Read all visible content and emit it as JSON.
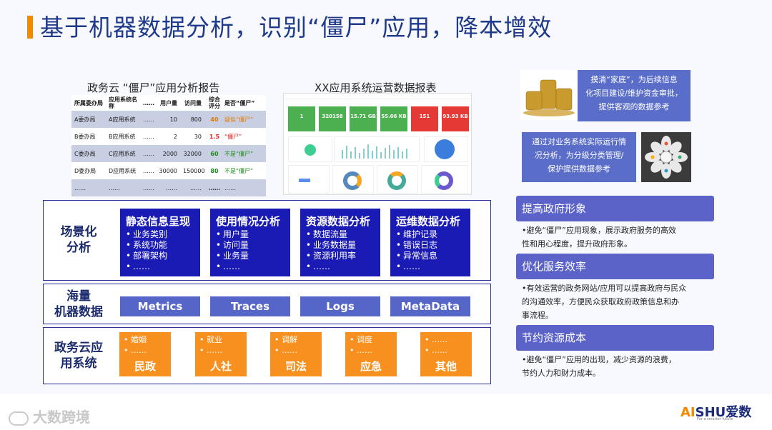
{
  "title": "基于机器数据分析，识别“僵尸”应用，降本增效",
  "report": {
    "heading": "政务云 “僵尸”应用分析报告",
    "columns": [
      "所属委办局",
      "应用系统名称",
      "……",
      "用户量",
      "访问量",
      "综合评分",
      "是否“僵尸”"
    ],
    "rows": [
      [
        "A委办局",
        "A应用系统",
        "……",
        "10",
        "800",
        "40",
        "疑似“僵尸”"
      ],
      [
        "B委办局",
        "B应用系统",
        "……",
        "2",
        "30",
        "1.5",
        "“僵尸”"
      ],
      [
        "C委办局",
        "C应用系统",
        "……",
        "2000",
        "32000",
        "60",
        "不是“僵尸”"
      ],
      [
        "D委办局",
        "D应用系统",
        "……",
        "30000",
        "150000",
        "80",
        "不是“僵尸”"
      ],
      [
        "……",
        "……",
        "……",
        "……",
        "……",
        "……",
        "……"
      ]
    ],
    "score_colors": [
      "#e07a00",
      "#e02020",
      "#1a8a1a",
      "#1a8a1a",
      "#333"
    ],
    "status_colors": [
      "#e07a00",
      "#e02020",
      "#1a8a1a",
      "#1a8a1a",
      "#333"
    ]
  },
  "dashboard": {
    "heading": "XX应用系统运营数据报表",
    "kpis": [
      {
        "value": "1",
        "color": "#4caf50"
      },
      {
        "value": "320158",
        "color": "#4caf50"
      },
      {
        "value": "15.71 GB",
        "color": "#4caf50"
      },
      {
        "value": "55.06 KB",
        "color": "#4caf50"
      },
      {
        "value": "151",
        "color": "#e53935"
      },
      {
        "value": "93.93 KB",
        "color": "#e53935"
      }
    ]
  },
  "right_boxes": {
    "box1": "摸清“家底”，为后续信息化项目建设/维护资金审批，提供客观的数据参考",
    "box1_lines": [
      "摸清“家底”，为后续信息",
      "化项目建设/维护资金审批，",
      "提供客观的数据参考"
    ],
    "box2_lines": [
      "通过对业务系统实际运行情",
      "况分析，为分级分类管理/",
      "保护提供数据参考"
    ]
  },
  "rows": {
    "scene_label": [
      "场景化",
      "分析"
    ],
    "machine_label": [
      "海量",
      "机器数据"
    ],
    "system_label": [
      "政务云应",
      "用系统"
    ]
  },
  "scenes": [
    {
      "title": "静态信息呈现",
      "items": [
        "业务类别",
        "系统功能",
        "部署架构",
        "……"
      ]
    },
    {
      "title": "使用情况分析",
      "items": [
        "用户量",
        "访问量",
        "业务量",
        "……"
      ]
    },
    {
      "title": "资源数据分析",
      "items": [
        "数据流量",
        "业务数据量",
        "资源利用率",
        "……"
      ]
    },
    {
      "title": "运维数据分析",
      "items": [
        "维护记录",
        "错误日志",
        "异常信息",
        "……"
      ]
    }
  ],
  "machine_data": [
    "Metrics",
    "Traces",
    "Logs",
    "MetaData"
  ],
  "systems": [
    {
      "items": [
        "婚姻",
        "……"
      ],
      "name": "民政"
    },
    {
      "items": [
        "就业",
        "……"
      ],
      "name": "人社"
    },
    {
      "items": [
        "调解",
        "……"
      ],
      "name": "司法"
    },
    {
      "items": [
        "调度",
        "……"
      ],
      "name": "应急"
    },
    {
      "items": [
        "……",
        "……"
      ],
      "name": "其他"
    }
  ],
  "benefits": [
    {
      "title": "提高政府形象",
      "lines": [
        "•避免“僵尸”应用现象，展示政府服务的高效",
        "性和用心程度，提升政府形象。"
      ]
    },
    {
      "title": "优化服务效率",
      "lines": [
        "•有效运营的政务网站/应用可以提高政府与民众",
        "的沟通效率，方便民众获取政府政策信息和办",
        "事流程。"
      ]
    },
    {
      "title": "节约资源成本",
      "lines": [
        "•避免“僵尸”应用的出现，减少资源的浪费，",
        "节约人力和财力成本。"
      ]
    }
  ],
  "footer": {
    "watermark": "大数跨境",
    "brand_ai": "AI",
    "brand_rest": "SHU爱数",
    "tagline": "For a smarter future"
  }
}
